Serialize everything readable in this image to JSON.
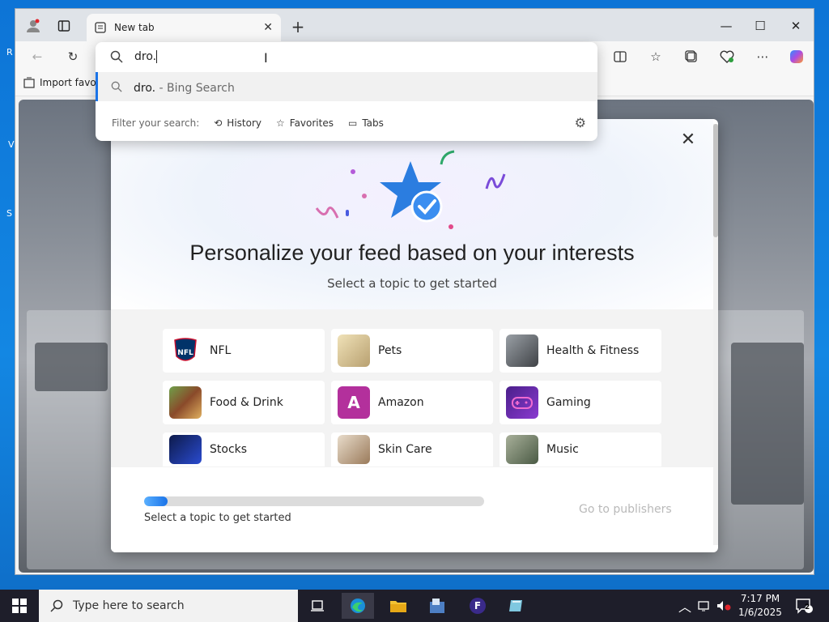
{
  "browser": {
    "tab_title": "New tab",
    "favorites_bar": {
      "import_label": "Import favor"
    }
  },
  "address_bar": {
    "value": "dro.",
    "suggestion": {
      "query": "dro.",
      "source": " - Bing Search"
    },
    "filter_label": "Filter your search:",
    "filters": [
      {
        "label": "History",
        "icon": "history-icon"
      },
      {
        "label": "Favorites",
        "icon": "star-icon"
      },
      {
        "label": "Tabs",
        "icon": "tabs-icon"
      }
    ]
  },
  "modal": {
    "title": "Personalize your feed based on your interests",
    "subtitle": "Select a topic to get started",
    "topics": [
      {
        "label": "NFL",
        "color": "#013369"
      },
      {
        "label": "Pets",
        "color": "#d8c08a"
      },
      {
        "label": "Health & Fitness",
        "color": "#6e6e6e"
      },
      {
        "label": "Food & Drink",
        "color": "#7a5a3a"
      },
      {
        "label": "Amazon",
        "color": "#b3309c",
        "letter": "A"
      },
      {
        "label": "Gaming",
        "color": "#6a2fb0"
      },
      {
        "label": "Stocks",
        "color": "#1b2f7a"
      },
      {
        "label": "Skin Care",
        "color": "#c9b9a8"
      },
      {
        "label": "Music",
        "color": "#5f6f55"
      }
    ],
    "progress_label": "Select a topic to get started",
    "progress_fraction": 0.07,
    "go_publishers": "Go to publishers"
  },
  "taskbar": {
    "search_placeholder": "Type here to search",
    "time": "7:17 PM",
    "date": "1/6/2025",
    "notification_count": "2"
  },
  "desktop": {
    "fragments": [
      "R",
      "V",
      "S"
    ]
  }
}
